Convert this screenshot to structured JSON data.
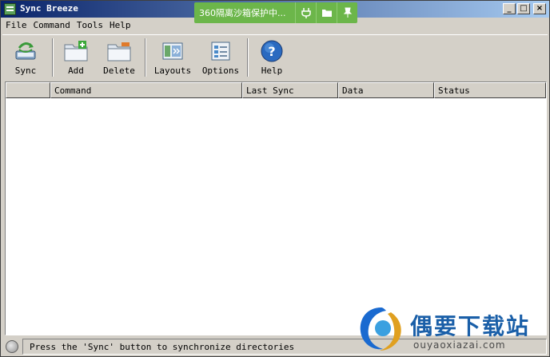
{
  "window": {
    "title": "Sync Breeze",
    "controls": {
      "minimize": "_",
      "maximize": "□",
      "close": "×"
    }
  },
  "sandbox_popup": {
    "text": "360隔离沙箱保护中...",
    "icons": [
      "plug-icon",
      "folder-icon",
      "pin-icon"
    ]
  },
  "menu": [
    "File",
    "Command",
    "Tools",
    "Help"
  ],
  "toolbar": {
    "sync": "Sync",
    "add": "Add",
    "delete": "Delete",
    "layouts": "Layouts",
    "options": "Options",
    "help": "Help"
  },
  "list": {
    "columns": [
      "",
      "Command",
      "Last Sync",
      "Data",
      "Status"
    ],
    "rows": []
  },
  "status": {
    "text": "Press the 'Sync' button to synchronize directories"
  },
  "watermark": {
    "title": "偶要下载站",
    "url": "ouyaoxiazai.com"
  },
  "colors": {
    "titlebar_start": "#0a246a",
    "titlebar_end": "#a6caf0",
    "sandbox": "#6cb64a",
    "watermark": "#1a5fa8"
  }
}
